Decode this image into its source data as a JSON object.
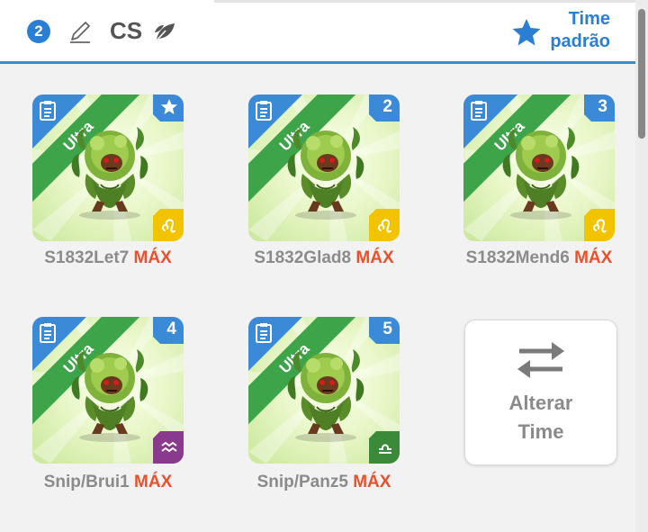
{
  "header": {
    "team_number": "2",
    "team_code": "CS",
    "team_name_line1": "Time",
    "team_name_line2": "padrão",
    "icons": {
      "edit": "pencil-icon",
      "element": "leaf-icon",
      "default": "star-icon"
    },
    "accent_color": "#2a7fd4"
  },
  "monsters": [
    {
      "name": "S1832Let7",
      "max": "MÁX",
      "rank_label": "Ultra",
      "slot": "★",
      "slot_icon": "star-icon",
      "element_icon": "leo-icon",
      "element_color": "#f2c400"
    },
    {
      "name": "S1832Glad8",
      "max": "MÁX",
      "rank_label": "Ultra",
      "slot": "2",
      "element_icon": "leo-icon",
      "element_color": "#f2c400"
    },
    {
      "name": "S1832Mend6",
      "max": "MÁX",
      "rank_label": "Ultra",
      "slot": "3",
      "element_icon": "leo-icon",
      "element_color": "#f2c400"
    },
    {
      "name": "Snip/Brui1",
      "max": "MÁX",
      "rank_label": "Ultra",
      "slot": "4",
      "element_icon": "aquarius-icon",
      "element_color": "#8a3a8c"
    },
    {
      "name": "Snip/Panz5",
      "max": "MÁX",
      "rank_label": "Ultra",
      "slot": "5",
      "element_icon": "libra-icon",
      "element_color": "#3a8a3a"
    }
  ],
  "change_team": {
    "line1": "Alterar",
    "line2": "Time",
    "icon": "swap-icon"
  },
  "colors": {
    "max": "#e8512a",
    "ultra_banner": "#3ea44a",
    "corner_blue": "#3a8ad8"
  }
}
